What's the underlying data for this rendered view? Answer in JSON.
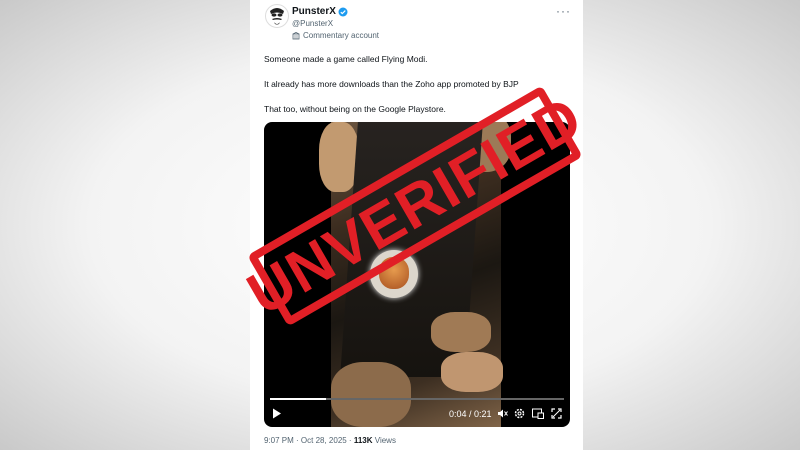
{
  "post": {
    "author": {
      "name": "PunsterX",
      "handle": "@PunsterX",
      "label": "Commentary account",
      "verified": true,
      "verified_color": "#1d9bf0"
    },
    "more_icon": "more-horizontal-icon",
    "lines": [
      "Someone made a game called Flying Modi.",
      "It already has more downloads than the Zoho app promoted by BJP",
      "That too, without being on the Google Playstore."
    ],
    "video": {
      "time": "0:04 / 0:21",
      "progress": 0.19,
      "icons": [
        "play-icon",
        "volume-icon",
        "closed-captions-icon",
        "settings-icon",
        "picture-in-picture-icon",
        "fullscreen-icon"
      ]
    },
    "timestamp": "9:07 PM · Oct 28, 2025 ·",
    "views_count": "113K",
    "views_label": "Views"
  },
  "stamp": {
    "text": "UNVERIFIED",
    "color": "#e11f26"
  }
}
